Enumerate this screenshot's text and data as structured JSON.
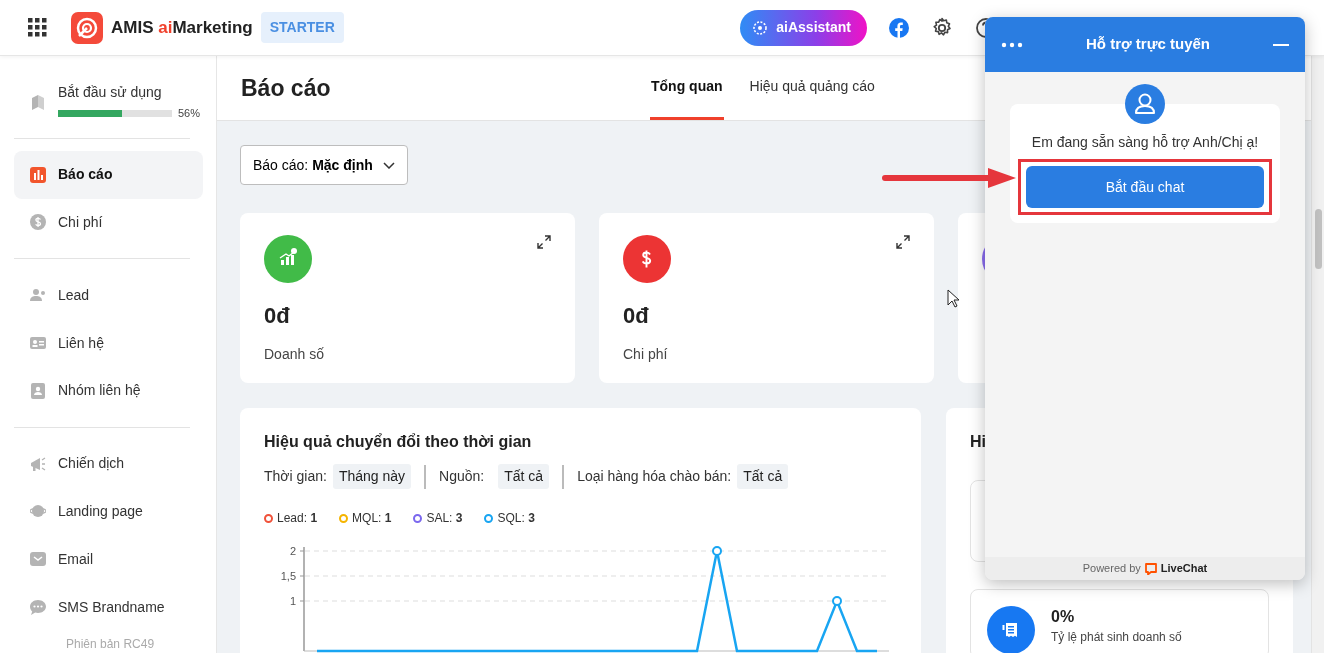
{
  "header": {
    "brand": {
      "prefix": "AMIS",
      "accent": "ai",
      "suffix": "Marketing"
    },
    "plan": "STARTER",
    "assistant": "aiAssistant"
  },
  "sidebar": {
    "onboarding": {
      "label": "Bắt đầu sử dụng",
      "level": 0.56,
      "percent": "56%"
    },
    "groups": [
      {
        "items": [
          {
            "label": "Báo cáo",
            "selected": true
          },
          {
            "label": "Chi phí",
            "selected": false
          }
        ]
      },
      {
        "items": [
          {
            "label": "Lead",
            "selected": false
          },
          {
            "label": "Liên hệ",
            "selected": false
          },
          {
            "label": "Nhóm liên hệ",
            "selected": false
          }
        ]
      },
      {
        "items": [
          {
            "label": "Chiến dịch",
            "selected": false
          },
          {
            "label": "Landing page",
            "selected": false
          },
          {
            "label": "Email",
            "selected": false
          },
          {
            "label": "SMS Brandname",
            "selected": false
          }
        ]
      }
    ],
    "version": "Phiên bản RC49"
  },
  "page": {
    "title": "Báo cáo",
    "tabs": [
      {
        "label": "Tổng quan",
        "selected": true
      },
      {
        "label": "Hiệu quả quảng cáo",
        "selected": false
      }
    ]
  },
  "report_select": {
    "label": "Báo cáo:",
    "value": "Mặc định"
  },
  "stats": [
    {
      "color": "#41bb48",
      "value": "0đ",
      "label": "Doanh số"
    },
    {
      "color": "#ec3434",
      "value": "0đ",
      "label": "Chi phí"
    }
  ],
  "conversion": {
    "title": "Hiệu quả chuyển đổi theo thời gian",
    "filters": [
      {
        "label": "Thời gian:",
        "value": "Tháng này"
      },
      {
        "label": "Nguồn:",
        "value": "Tất cả"
      },
      {
        "label": "Loại hàng hóa chào bán:",
        "value": "Tất cả"
      }
    ],
    "legend": [
      {
        "label": "Lead:",
        "value": "1",
        "color": "#f0523a"
      },
      {
        "label": "MQL:",
        "value": "1",
        "color": "#f5b400"
      },
      {
        "label": "SAL:",
        "value": "3",
        "color": "#7b68ee"
      },
      {
        "label": "SQL:",
        "value": "3",
        "color": "#18a5f2"
      }
    ],
    "chart_data": {
      "type": "line",
      "ylim": [
        0,
        2
      ],
      "yticks": [
        1,
        {
          "value": 1.5,
          "label": "1,5"
        },
        2
      ],
      "series": [
        {
          "color": "#18a5f2",
          "values": [
            0,
            0,
            0,
            0,
            0,
            0,
            0,
            0,
            0,
            0,
            0,
            0,
            0,
            0,
            0,
            0,
            0,
            0,
            0,
            0,
            2,
            0,
            0,
            0,
            0,
            0,
            1,
            0,
            0
          ]
        }
      ]
    }
  },
  "side_panel": {
    "title": "Hi",
    "metrics": [
      {
        "value": "0%",
        "label": "Tỷ lệ phát sinh doanh số"
      }
    ]
  },
  "chat": {
    "title": "Hỗ trợ trực tuyến",
    "message": "Em đang sẵn sàng hỗ trợ Anh/Chị ạ!",
    "button": "Bắt đầu chat",
    "footer": {
      "prefix": "Powered by",
      "brand": "LiveChat"
    }
  }
}
